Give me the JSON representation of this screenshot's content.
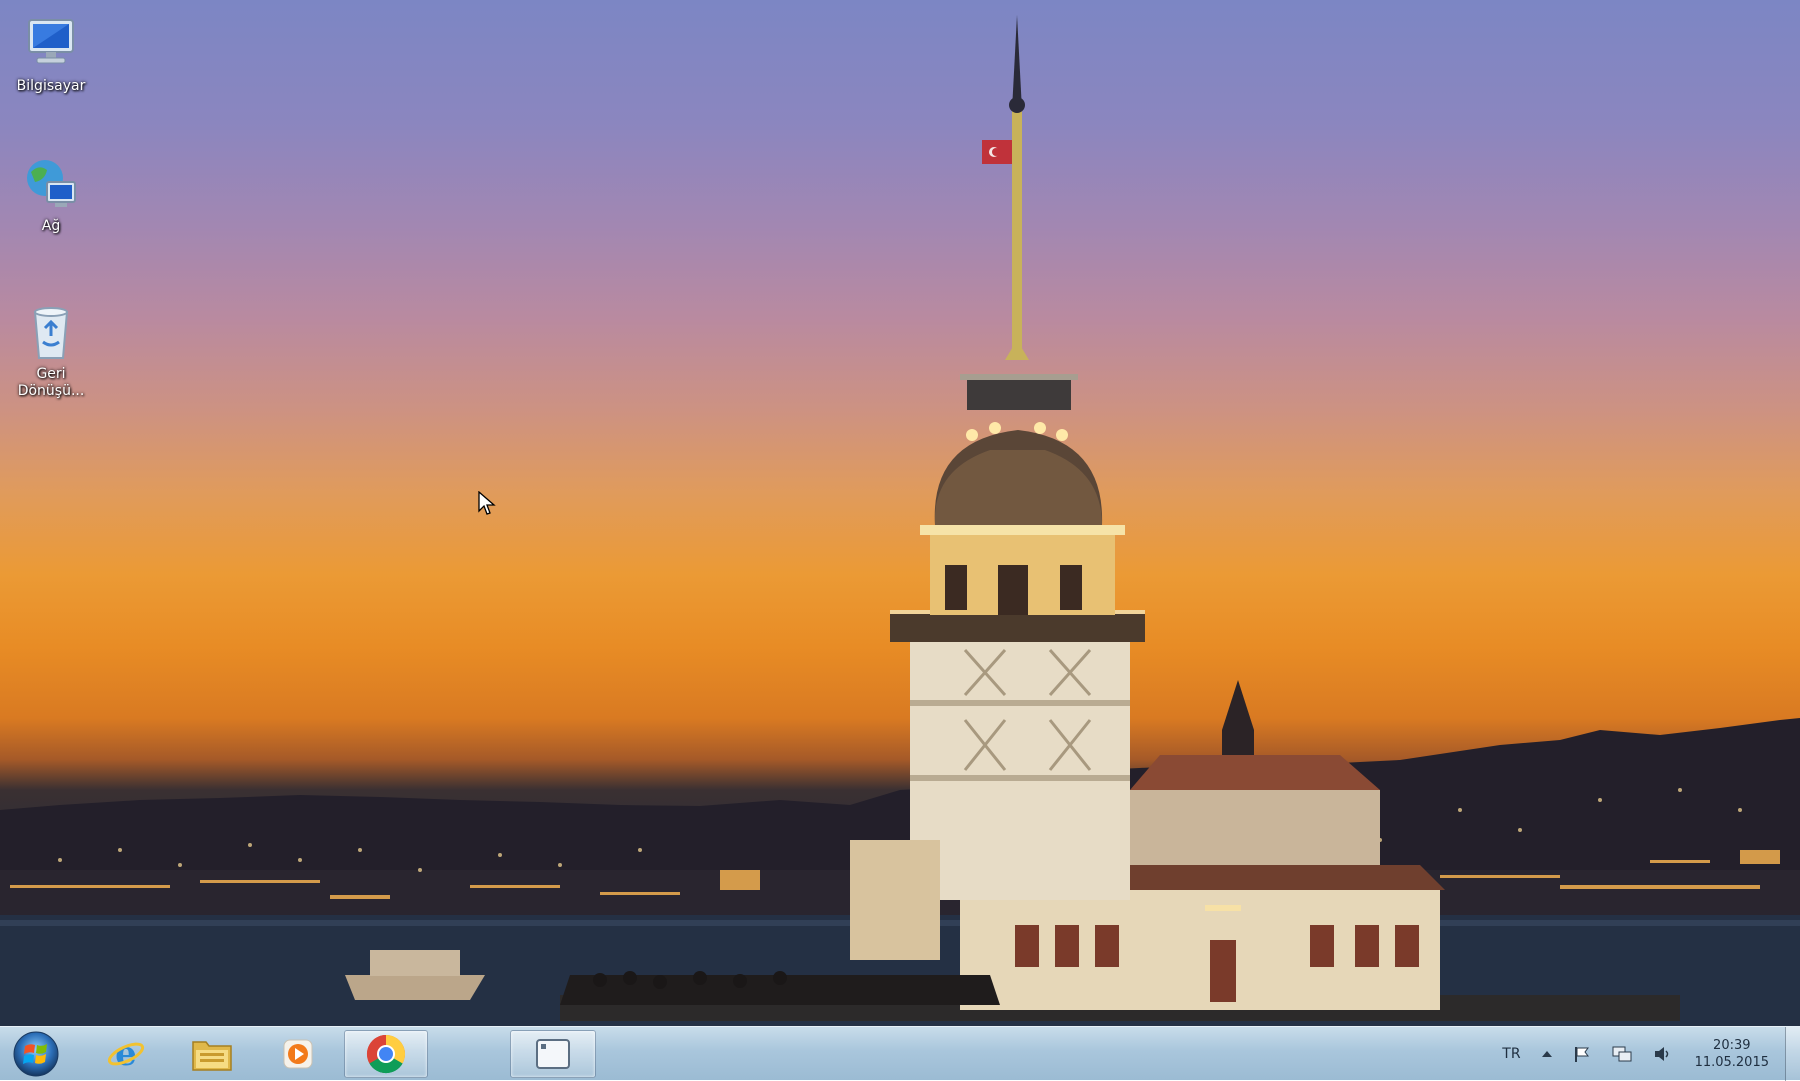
{
  "desktop": {
    "icons": [
      {
        "label": "Bilgisayar",
        "icon": "computer-icon"
      },
      {
        "label": "Ağ",
        "icon": "network-icon"
      },
      {
        "label": "Geri Dönüşü...",
        "icon": "recycle-bin-icon"
      }
    ]
  },
  "taskbar": {
    "start_icon": "windows-start-icon",
    "pinned": [
      {
        "name": "Internet Explorer",
        "icon": "internet-explorer-icon",
        "active": false
      },
      {
        "name": "Windows Explorer",
        "icon": "folder-icon",
        "active": false
      },
      {
        "name": "Windows Media Player",
        "icon": "media-player-icon",
        "active": false
      },
      {
        "name": "Google Chrome",
        "icon": "chrome-icon",
        "active": true
      },
      {
        "name": "Application window",
        "icon": "app-window-icon",
        "active": true
      }
    ],
    "tray": {
      "language": "TR",
      "clock_time": "20:39",
      "clock_date": "11.05.2015"
    }
  },
  "colors": {
    "taskbar_top": "#c8dcea",
    "taskbar_bottom": "#9bbbd3",
    "sky_top": "#7c86c4",
    "sunset_orange": "#eb9a35"
  }
}
